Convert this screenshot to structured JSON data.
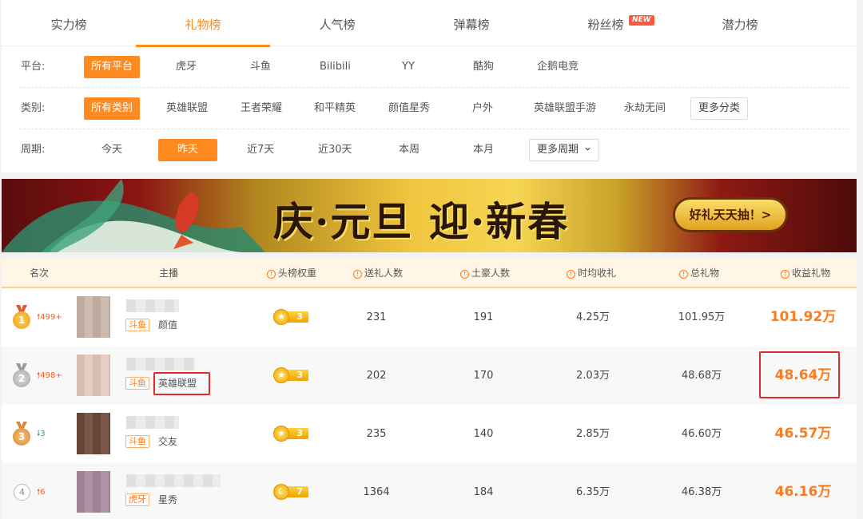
{
  "tabs": [
    {
      "label": "实力榜",
      "active": false
    },
    {
      "label": "礼物榜",
      "active": true
    },
    {
      "label": "人气榜",
      "active": false
    },
    {
      "label": "弹幕榜",
      "active": false
    },
    {
      "label": "粉丝榜",
      "active": false,
      "badge": "NEW"
    },
    {
      "label": "潜力榜",
      "active": false
    }
  ],
  "filters": {
    "platform": {
      "label": "平台:",
      "options": [
        "所有平台",
        "虎牙",
        "斗鱼",
        "Bilibili",
        "YY",
        "酷狗",
        "企鹅电竞"
      ],
      "selected": "所有平台"
    },
    "category": {
      "label": "类别:",
      "options": [
        "所有类别",
        "英雄联盟",
        "王者荣耀",
        "和平精英",
        "颜值星秀",
        "户外",
        "英雄联盟手游",
        "永劫无间"
      ],
      "selected": "所有类别",
      "more_label": "更多分类"
    },
    "period": {
      "label": "周期:",
      "options": [
        "今天",
        "昨天",
        "近7天",
        "近30天",
        "本周",
        "本月"
      ],
      "selected": "昨天",
      "more_label": "更多周期",
      "more_icon": "chevron-down-icon"
    }
  },
  "banner": {
    "text": "庆·元旦 迎·新春",
    "button_label": "好礼天天抽！>"
  },
  "table": {
    "headers": {
      "rank": "名次",
      "streamer": "主播",
      "weight": "头榜权重",
      "givers": "送礼人数",
      "tycoons": "土豪人数",
      "hourly": "时均收礼",
      "total": "总礼物",
      "revenue": "收益礼物"
    },
    "info_icon": "info-circle-icon",
    "rows": [
      {
        "rank": "1",
        "trend": "499+",
        "trend_dir": "up",
        "platform": "斗鱼",
        "category": "颜值",
        "weight": "3",
        "weight_icon": "star-icon",
        "givers": "231",
        "tycoons": "191",
        "hourly": "4.25万",
        "total": "101.95万",
        "revenue": "101.92万"
      },
      {
        "rank": "2",
        "trend": "498+",
        "trend_dir": "up",
        "platform": "斗鱼",
        "category": "英雄联盟",
        "weight": "3",
        "weight_icon": "star-icon",
        "givers": "202",
        "tycoons": "170",
        "hourly": "2.03万",
        "total": "48.68万",
        "revenue": "48.64万"
      },
      {
        "rank": "3",
        "trend": "3",
        "trend_dir": "down",
        "platform": "斗鱼",
        "category": "交友",
        "weight": "3",
        "weight_icon": "star-icon",
        "givers": "235",
        "tycoons": "140",
        "hourly": "2.85万",
        "total": "46.60万",
        "revenue": "46.57万"
      },
      {
        "rank": "4",
        "trend": "6",
        "trend_dir": "up",
        "platform": "虎牙",
        "category": "星秀",
        "weight": "7",
        "weight_icon": "moon-icon",
        "givers": "1364",
        "tycoons": "184",
        "hourly": "6.35万",
        "total": "46.38万",
        "revenue": "46.16万"
      }
    ]
  },
  "colors": {
    "accent": "#ff8a1f",
    "gold": "#f6a11a",
    "silver": "#b5b5b5",
    "bronze": "#e8a64a",
    "highlight_box": "#e3282a",
    "trend_up": "#ff5a1f",
    "trend_down": "#26a65b"
  }
}
